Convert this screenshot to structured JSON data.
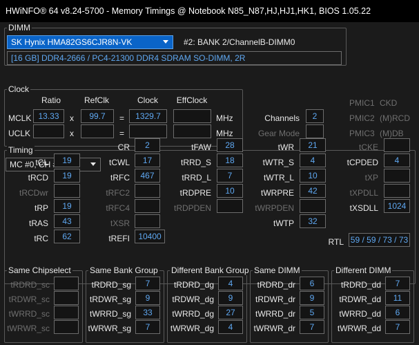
{
  "window": {
    "title": "HWiNFO® 64 v8.24-5700 - Memory Timings @ Notebook N85_N87,HJ,HJ1,HK1, BIOS 1.05.22"
  },
  "dimm": {
    "label": "DIMM",
    "selected": "SK Hynix HMA82GS6CJR8N-VK",
    "slot": "#2: BANK 2/ChannelB-DIMM0",
    "info": "[16 GB] DDR4-2666 / PC4-21300 DDR4 SDRAM SO-DIMM, 2R"
  },
  "clock": {
    "label": "Clock",
    "headers": {
      "ratio": "Ratio",
      "refclk": "RefClk",
      "clock": "Clock",
      "effclock": "EffClock"
    },
    "mclk": {
      "label": "MCLK",
      "ratio": "13.33",
      "x": "x",
      "refclk": "99.7",
      "eq": "=",
      "clock": "1329.7",
      "effclock": "",
      "unit": "MHz"
    },
    "uclk": {
      "label": "UCLK",
      "ratio": "",
      "x": "x",
      "refclk": "",
      "eq": "=",
      "clock": "",
      "effclock": "",
      "unit": "MHz"
    },
    "channels_label": "Channels",
    "channels": "2",
    "gear_label": "Gear Mode",
    "gear": "",
    "pmic": [
      {
        "name": "PMIC1",
        "role": "CKD"
      },
      {
        "name": "PMIC2",
        "role": "(M)RCD"
      },
      {
        "name": "PMIC3",
        "role": "(M)DB"
      }
    ]
  },
  "timing": {
    "label": "Timing",
    "selector": "MC #0, CH #0",
    "col1": [
      {
        "label": "tCL",
        "value": "19"
      },
      {
        "label": "tRCD",
        "value": "19"
      },
      {
        "label": "tRCDwr",
        "value": ""
      },
      {
        "label": "tRP",
        "value": "19"
      },
      {
        "label": "tRAS",
        "value": "43"
      },
      {
        "label": "tRC",
        "value": "62"
      }
    ],
    "col2": [
      {
        "label": "CR",
        "value": "2"
      },
      {
        "label": "tCWL",
        "value": "17"
      },
      {
        "label": "tRFC",
        "value": "467"
      },
      {
        "label": "tRFC2",
        "value": ""
      },
      {
        "label": "tRFC4",
        "value": ""
      },
      {
        "label": "tXSR",
        "value": ""
      },
      {
        "label": "tREFI",
        "value": "10400"
      }
    ],
    "col3": [
      {
        "label": "tFAW",
        "value": "28"
      },
      {
        "label": "tRRD_S",
        "value": "18"
      },
      {
        "label": "tRRD_L",
        "value": "7"
      },
      {
        "label": "tRDPRE",
        "value": "10"
      },
      {
        "label": "tRDPDEN",
        "value": ""
      }
    ],
    "col4": [
      {
        "label": "tWR",
        "value": "21"
      },
      {
        "label": "tWTR_S",
        "value": "4"
      },
      {
        "label": "tWTR_L",
        "value": "10"
      },
      {
        "label": "tWRPRE",
        "value": "42"
      },
      {
        "label": "tWRPDEN",
        "value": ""
      },
      {
        "label": "tWTP",
        "value": "32"
      }
    ],
    "col5": [
      {
        "label": "tCKE",
        "value": ""
      },
      {
        "label": "tCPDED",
        "value": "4"
      },
      {
        "label": "tXP",
        "value": ""
      },
      {
        "label": "tXPDLL",
        "value": ""
      },
      {
        "label": "tXSDLL",
        "value": "1024"
      }
    ],
    "rtl_label": "RTL",
    "rtl": "59 / 59 / 73 / 73"
  },
  "groups": [
    {
      "title": "Same Chipselect",
      "rows": [
        {
          "label": "tRDRD_sc",
          "value": ""
        },
        {
          "label": "tRDWR_sc",
          "value": ""
        },
        {
          "label": "tWRRD_sc",
          "value": ""
        },
        {
          "label": "tWRWR_sc",
          "value": ""
        }
      ]
    },
    {
      "title": "Same Bank Group",
      "rows": [
        {
          "label": "tRDRD_sg",
          "value": "7"
        },
        {
          "label": "tRDWR_sg",
          "value": "9"
        },
        {
          "label": "tWRRD_sg",
          "value": "33"
        },
        {
          "label": "tWRWR_sg",
          "value": "7"
        }
      ]
    },
    {
      "title": "Different Bank Group",
      "rows": [
        {
          "label": "tRDRD_dg",
          "value": "4"
        },
        {
          "label": "tRDWR_dg",
          "value": "9"
        },
        {
          "label": "tWRRD_dg",
          "value": "27"
        },
        {
          "label": "tWRWR_dg",
          "value": "4"
        }
      ]
    },
    {
      "title": "Same DIMM",
      "rows": [
        {
          "label": "tRDRD_dr",
          "value": "6"
        },
        {
          "label": "tRDWR_dr",
          "value": "9"
        },
        {
          "label": "tWRRD_dr",
          "value": "5"
        },
        {
          "label": "tWRWR_dr",
          "value": "7"
        }
      ]
    },
    {
      "title": "Different DIMM",
      "rows": [
        {
          "label": "tRDRD_dd",
          "value": "7"
        },
        {
          "label": "tRDWR_dd",
          "value": "11"
        },
        {
          "label": "tWRRD_dd",
          "value": "6"
        },
        {
          "label": "tWRWR_dd",
          "value": "7"
        }
      ]
    }
  ]
}
